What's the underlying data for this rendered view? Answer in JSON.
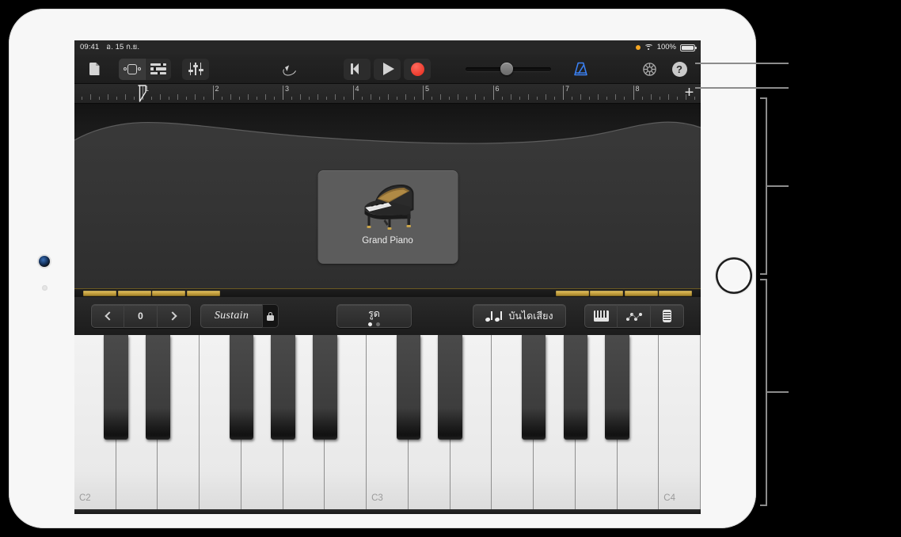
{
  "status_bar": {
    "time": "09:41",
    "date": "อ. 15 ก.ย.",
    "battery_percent": "100%",
    "recording_dot": "orange-dot-icon",
    "wifi": "wifi-icon",
    "battery": "battery-icon"
  },
  "toolbar": {
    "my_songs_label": "document-icon",
    "track_view_label": "track-view-icon",
    "mixer_view_label": "mixer-view-icon",
    "settings_fx_label": "fader-sliders-icon",
    "undo_label": "undo-icon",
    "rewind_label": "rewind-icon",
    "play_label": "play-icon",
    "record_label": "record-icon",
    "metronome_label": "metronome-icon",
    "metronome_color": "#3b82f6",
    "record_color": "#ed3b2d",
    "settings_label": "gear-icon",
    "help_label": "?",
    "master_volume_value": 48
  },
  "ruler": {
    "bars": [
      "1",
      "2",
      "3",
      "4",
      "5",
      "6",
      "7",
      "8"
    ],
    "add_label": "+",
    "playhead_bar": "1"
  },
  "instrument": {
    "patch_name": "Grand Piano",
    "patch_art": "grand-piano-icon"
  },
  "controls": {
    "octave_down": "chevron-left-icon",
    "octave_value": "0",
    "octave_up": "chevron-right-icon",
    "sustain_label": "Sustain",
    "sustain_lock": "lock-icon",
    "glissando_label": "รูด",
    "scale_label": "บันไดเสียง",
    "keyboard_view": "keyboard-icon",
    "arpeggiator_view": "arpeggiator-icon",
    "fader_view": "fader-icon"
  },
  "keyboard": {
    "octave_labels": [
      "C2",
      "C3",
      "C4"
    ],
    "white_key_count": 15,
    "labeled_key_indexes": [
      0,
      7,
      14
    ]
  },
  "colors": {
    "gold_trim": "#c9a441",
    "screen_bg": "#1b1b1b",
    "device_body": "#f7f7f7"
  }
}
